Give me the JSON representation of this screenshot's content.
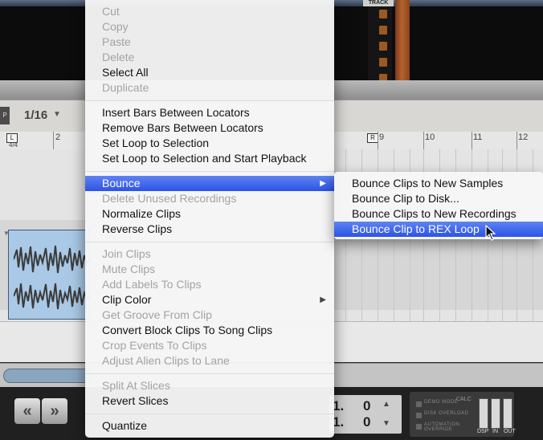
{
  "background": {
    "track_label": "TRACK",
    "p_button": "P",
    "quantize_value": "1/16",
    "ruler": {
      "time_signature": "4/4",
      "bars": [
        "2",
        "9",
        "10",
        "11",
        "12"
      ],
      "left_locator": "L",
      "right_locator": "R"
    },
    "position": {
      "bars": "1.",
      "beats": "1.",
      "val1": "0",
      "val2": "0"
    },
    "dsp_labels": [
      "DSP",
      "IN",
      "OUT"
    ],
    "status_lines": [
      "DEMO MODE",
      "DISK OVERLOAD",
      "AUTOMATION OVERRIDE"
    ],
    "calc_label": "CALC"
  },
  "menu": {
    "groups": [
      [
        {
          "label": "Cut",
          "enabled": false
        },
        {
          "label": "Copy",
          "enabled": false
        },
        {
          "label": "Paste",
          "enabled": false
        },
        {
          "label": "Delete",
          "enabled": false
        },
        {
          "label": "Select All",
          "enabled": true
        },
        {
          "label": "Duplicate",
          "enabled": false
        }
      ],
      [
        {
          "label": "Insert Bars Between Locators",
          "enabled": true
        },
        {
          "label": "Remove Bars Between Locators",
          "enabled": true
        },
        {
          "label": "Set Loop to Selection",
          "enabled": true
        },
        {
          "label": "Set Loop to Selection and Start Playback",
          "enabled": true
        }
      ],
      [
        {
          "label": "Bounce",
          "enabled": true,
          "submenu": true,
          "highlighted": true
        },
        {
          "label": "Delete Unused Recordings",
          "enabled": false
        },
        {
          "label": "Normalize Clips",
          "enabled": true
        },
        {
          "label": "Reverse Clips",
          "enabled": true
        }
      ],
      [
        {
          "label": "Join Clips",
          "enabled": false
        },
        {
          "label": "Mute Clips",
          "enabled": false
        },
        {
          "label": "Add Labels To Clips",
          "enabled": false
        },
        {
          "label": "Clip Color",
          "enabled": true,
          "submenu": true
        },
        {
          "label": "Get Groove From Clip",
          "enabled": false
        },
        {
          "label": "Convert Block Clips To Song Clips",
          "enabled": true
        },
        {
          "label": "Crop Events To Clips",
          "enabled": false
        },
        {
          "label": "Adjust Alien Clips to Lane",
          "enabled": false
        }
      ],
      [
        {
          "label": "Split At Slices",
          "enabled": false
        },
        {
          "label": "Revert Slices",
          "enabled": true
        }
      ],
      [
        {
          "label": "Quantize",
          "enabled": true
        }
      ]
    ]
  },
  "submenu": {
    "items": [
      {
        "label": "Bounce Clips to New Samples",
        "highlighted": false
      },
      {
        "label": "Bounce Clip to Disk...",
        "highlighted": false
      },
      {
        "label": "Bounce Clips to New Recordings",
        "highlighted": false
      },
      {
        "label": "Bounce Clip to REX Loop",
        "highlighted": true
      }
    ]
  },
  "colors": {
    "highlight": "#3f67ea",
    "clip": "#a9c9e6",
    "disabled_text": "#a3a3a3"
  },
  "icons": {
    "submenu_arrow": "triangle-right-icon",
    "rewind": "rewind-icon",
    "forward": "fast-forward-icon",
    "cursor": "arrow-cursor-icon"
  }
}
